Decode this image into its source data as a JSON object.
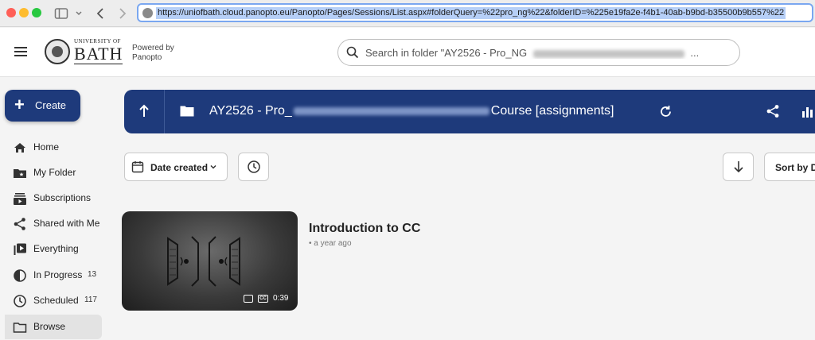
{
  "browser": {
    "url": "https://uniofbath.cloud.panopto.eu/Panopto/Pages/Sessions/List.aspx#folderQuery=%22pro_ng%22&folderID=%225e19fa2e-f4b1-40ab-b9bd-b35500b9b557%22"
  },
  "header": {
    "logo_small": "UNIVERSITY OF",
    "logo_big": "BATH",
    "powered_line1": "Powered by",
    "powered_line2": "Panopto",
    "search_text": "Search in folder \"AY2526 - Pro_NG",
    "search_suffix": "..."
  },
  "sidebar": {
    "create_label": "Create",
    "items": [
      {
        "label": "Home",
        "icon": "home-icon"
      },
      {
        "label": "My Folder",
        "icon": "my-folder-icon"
      },
      {
        "label": "Subscriptions",
        "icon": "subscriptions-icon"
      },
      {
        "label": "Shared with Me",
        "icon": "share-icon"
      },
      {
        "label": "Everything",
        "icon": "everything-icon"
      },
      {
        "label": "In Progress",
        "icon": "in-progress-icon",
        "badge": "13"
      },
      {
        "label": "Scheduled",
        "icon": "clock-icon",
        "badge": "117"
      },
      {
        "label": "Browse",
        "icon": "folder-icon",
        "active": true
      }
    ]
  },
  "folder": {
    "title_prefix": "AY2526 - Pro_",
    "title_suffix": "Course [assignments]"
  },
  "toolbar": {
    "date_label": "Date created",
    "sort_label": "Sort by Da"
  },
  "session": {
    "title": "Introduction to CC",
    "meta": "• a year ago",
    "duration": "0:39",
    "cc_label": "CC"
  },
  "colors": {
    "brand": "#1e3a7b"
  }
}
